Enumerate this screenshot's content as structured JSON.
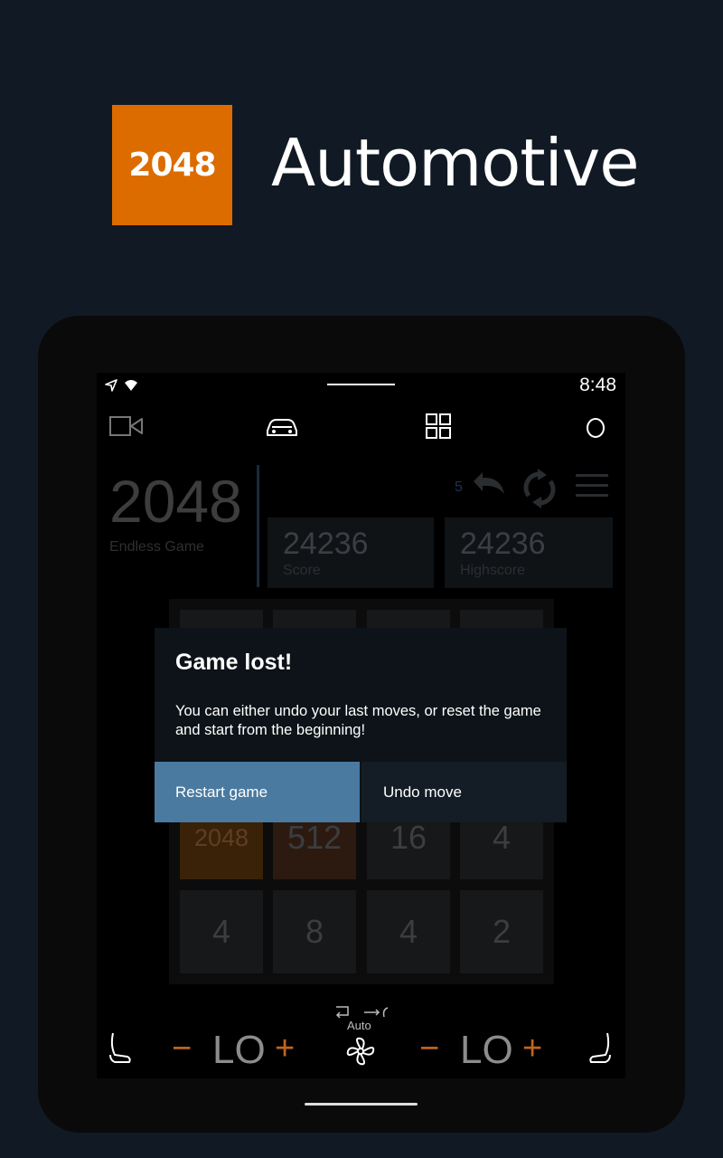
{
  "promo": {
    "logo_text": "2048",
    "headline": "Automotive"
  },
  "status_bar": {
    "time": "8:48"
  },
  "top_nav": {
    "icons": [
      "video-icon",
      "car-icon",
      "apps-grid-icon",
      "assistant-circle-icon"
    ]
  },
  "game": {
    "title": "2048",
    "mode": "Endless Game",
    "undo_count": "5",
    "score": {
      "value": "24236",
      "label": "Score"
    },
    "highscore": {
      "value": "24236",
      "label": "Highscore"
    }
  },
  "board": {
    "visible_rows": [
      [
        "2048",
        "512",
        "16",
        "4"
      ],
      [
        "4",
        "8",
        "4",
        "2"
      ]
    ],
    "colors": {
      "tile_2048": "#3a2208",
      "tile_512": "#2c1a10",
      "tile_default": "#161819"
    }
  },
  "dialog": {
    "title": "Game lost!",
    "message": "You can either undo your last moves, or reset the game and start from the beginning!",
    "restart_label": "Restart game",
    "undo_label": "Undo move"
  },
  "climate": {
    "left_minus": "−",
    "left_temp": "LO",
    "left_plus": "+",
    "auto_label": "Auto",
    "right_minus": "−",
    "right_temp": "LO",
    "right_plus": "+"
  },
  "colors": {
    "background": "#111a24",
    "logo": "#dc6c00",
    "accent_button": "#4a7aa0",
    "climate_accent": "#c0641c"
  }
}
